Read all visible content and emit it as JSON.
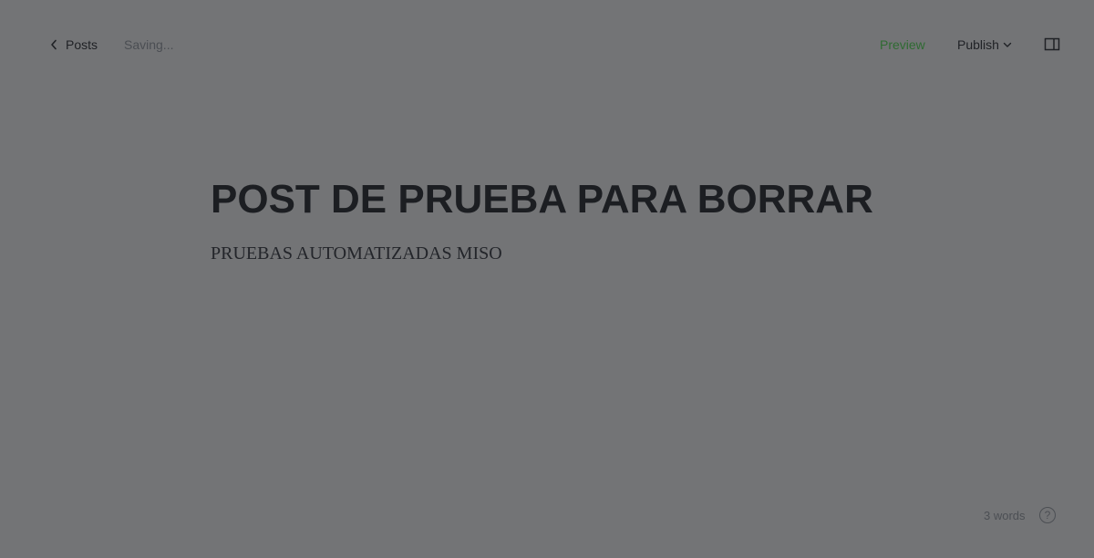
{
  "header": {
    "back_label": "Posts",
    "status": "Saving...",
    "preview_label": "Preview",
    "publish_label": "Publish",
    "icons": {
      "back": "chevron-left-icon",
      "publish_menu": "chevron-down-icon",
      "sidebar": "sidebar-panel-icon"
    }
  },
  "editor": {
    "title": "POST DE PRUEBA PARA BORRAR",
    "body": "PRUEBAS AUTOMATIZADAS MISO"
  },
  "footer": {
    "word_count": "3 words",
    "help_label": "?"
  },
  "colors": {
    "background": "#737476",
    "text": "#1c1e22",
    "accent_preview": "#2f6b32",
    "muted": "#4c4f54"
  }
}
